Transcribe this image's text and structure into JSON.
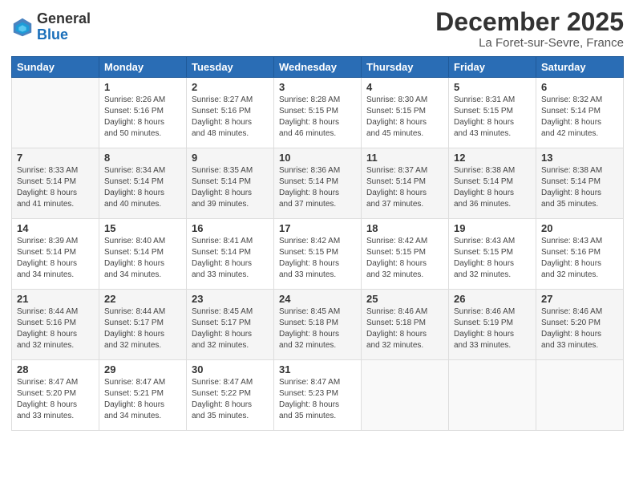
{
  "header": {
    "logo_general": "General",
    "logo_blue": "Blue",
    "month_title": "December 2025",
    "location": "La Foret-sur-Sevre, France"
  },
  "days_of_week": [
    "Sunday",
    "Monday",
    "Tuesday",
    "Wednesday",
    "Thursday",
    "Friday",
    "Saturday"
  ],
  "weeks": [
    [
      {
        "day": "",
        "sunrise": "",
        "sunset": "",
        "daylight": ""
      },
      {
        "day": "1",
        "sunrise": "Sunrise: 8:26 AM",
        "sunset": "Sunset: 5:16 PM",
        "daylight": "Daylight: 8 hours and 50 minutes."
      },
      {
        "day": "2",
        "sunrise": "Sunrise: 8:27 AM",
        "sunset": "Sunset: 5:16 PM",
        "daylight": "Daylight: 8 hours and 48 minutes."
      },
      {
        "day": "3",
        "sunrise": "Sunrise: 8:28 AM",
        "sunset": "Sunset: 5:15 PM",
        "daylight": "Daylight: 8 hours and 46 minutes."
      },
      {
        "day": "4",
        "sunrise": "Sunrise: 8:30 AM",
        "sunset": "Sunset: 5:15 PM",
        "daylight": "Daylight: 8 hours and 45 minutes."
      },
      {
        "day": "5",
        "sunrise": "Sunrise: 8:31 AM",
        "sunset": "Sunset: 5:15 PM",
        "daylight": "Daylight: 8 hours and 43 minutes."
      },
      {
        "day": "6",
        "sunrise": "Sunrise: 8:32 AM",
        "sunset": "Sunset: 5:14 PM",
        "daylight": "Daylight: 8 hours and 42 minutes."
      }
    ],
    [
      {
        "day": "7",
        "sunrise": "Sunrise: 8:33 AM",
        "sunset": "Sunset: 5:14 PM",
        "daylight": "Daylight: 8 hours and 41 minutes."
      },
      {
        "day": "8",
        "sunrise": "Sunrise: 8:34 AM",
        "sunset": "Sunset: 5:14 PM",
        "daylight": "Daylight: 8 hours and 40 minutes."
      },
      {
        "day": "9",
        "sunrise": "Sunrise: 8:35 AM",
        "sunset": "Sunset: 5:14 PM",
        "daylight": "Daylight: 8 hours and 39 minutes."
      },
      {
        "day": "10",
        "sunrise": "Sunrise: 8:36 AM",
        "sunset": "Sunset: 5:14 PM",
        "daylight": "Daylight: 8 hours and 37 minutes."
      },
      {
        "day": "11",
        "sunrise": "Sunrise: 8:37 AM",
        "sunset": "Sunset: 5:14 PM",
        "daylight": "Daylight: 8 hours and 37 minutes."
      },
      {
        "day": "12",
        "sunrise": "Sunrise: 8:38 AM",
        "sunset": "Sunset: 5:14 PM",
        "daylight": "Daylight: 8 hours and 36 minutes."
      },
      {
        "day": "13",
        "sunrise": "Sunrise: 8:38 AM",
        "sunset": "Sunset: 5:14 PM",
        "daylight": "Daylight: 8 hours and 35 minutes."
      }
    ],
    [
      {
        "day": "14",
        "sunrise": "Sunrise: 8:39 AM",
        "sunset": "Sunset: 5:14 PM",
        "daylight": "Daylight: 8 hours and 34 minutes."
      },
      {
        "day": "15",
        "sunrise": "Sunrise: 8:40 AM",
        "sunset": "Sunset: 5:14 PM",
        "daylight": "Daylight: 8 hours and 34 minutes."
      },
      {
        "day": "16",
        "sunrise": "Sunrise: 8:41 AM",
        "sunset": "Sunset: 5:14 PM",
        "daylight": "Daylight: 8 hours and 33 minutes."
      },
      {
        "day": "17",
        "sunrise": "Sunrise: 8:42 AM",
        "sunset": "Sunset: 5:15 PM",
        "daylight": "Daylight: 8 hours and 33 minutes."
      },
      {
        "day": "18",
        "sunrise": "Sunrise: 8:42 AM",
        "sunset": "Sunset: 5:15 PM",
        "daylight": "Daylight: 8 hours and 32 minutes."
      },
      {
        "day": "19",
        "sunrise": "Sunrise: 8:43 AM",
        "sunset": "Sunset: 5:15 PM",
        "daylight": "Daylight: 8 hours and 32 minutes."
      },
      {
        "day": "20",
        "sunrise": "Sunrise: 8:43 AM",
        "sunset": "Sunset: 5:16 PM",
        "daylight": "Daylight: 8 hours and 32 minutes."
      }
    ],
    [
      {
        "day": "21",
        "sunrise": "Sunrise: 8:44 AM",
        "sunset": "Sunset: 5:16 PM",
        "daylight": "Daylight: 8 hours and 32 minutes."
      },
      {
        "day": "22",
        "sunrise": "Sunrise: 8:44 AM",
        "sunset": "Sunset: 5:17 PM",
        "daylight": "Daylight: 8 hours and 32 minutes."
      },
      {
        "day": "23",
        "sunrise": "Sunrise: 8:45 AM",
        "sunset": "Sunset: 5:17 PM",
        "daylight": "Daylight: 8 hours and 32 minutes."
      },
      {
        "day": "24",
        "sunrise": "Sunrise: 8:45 AM",
        "sunset": "Sunset: 5:18 PM",
        "daylight": "Daylight: 8 hours and 32 minutes."
      },
      {
        "day": "25",
        "sunrise": "Sunrise: 8:46 AM",
        "sunset": "Sunset: 5:18 PM",
        "daylight": "Daylight: 8 hours and 32 minutes."
      },
      {
        "day": "26",
        "sunrise": "Sunrise: 8:46 AM",
        "sunset": "Sunset: 5:19 PM",
        "daylight": "Daylight: 8 hours and 33 minutes."
      },
      {
        "day": "27",
        "sunrise": "Sunrise: 8:46 AM",
        "sunset": "Sunset: 5:20 PM",
        "daylight": "Daylight: 8 hours and 33 minutes."
      }
    ],
    [
      {
        "day": "28",
        "sunrise": "Sunrise: 8:47 AM",
        "sunset": "Sunset: 5:20 PM",
        "daylight": "Daylight: 8 hours and 33 minutes."
      },
      {
        "day": "29",
        "sunrise": "Sunrise: 8:47 AM",
        "sunset": "Sunset: 5:21 PM",
        "daylight": "Daylight: 8 hours and 34 minutes."
      },
      {
        "day": "30",
        "sunrise": "Sunrise: 8:47 AM",
        "sunset": "Sunset: 5:22 PM",
        "daylight": "Daylight: 8 hours and 35 minutes."
      },
      {
        "day": "31",
        "sunrise": "Sunrise: 8:47 AM",
        "sunset": "Sunset: 5:23 PM",
        "daylight": "Daylight: 8 hours and 35 minutes."
      },
      {
        "day": "",
        "sunrise": "",
        "sunset": "",
        "daylight": ""
      },
      {
        "day": "",
        "sunrise": "",
        "sunset": "",
        "daylight": ""
      },
      {
        "day": "",
        "sunrise": "",
        "sunset": "",
        "daylight": ""
      }
    ]
  ]
}
